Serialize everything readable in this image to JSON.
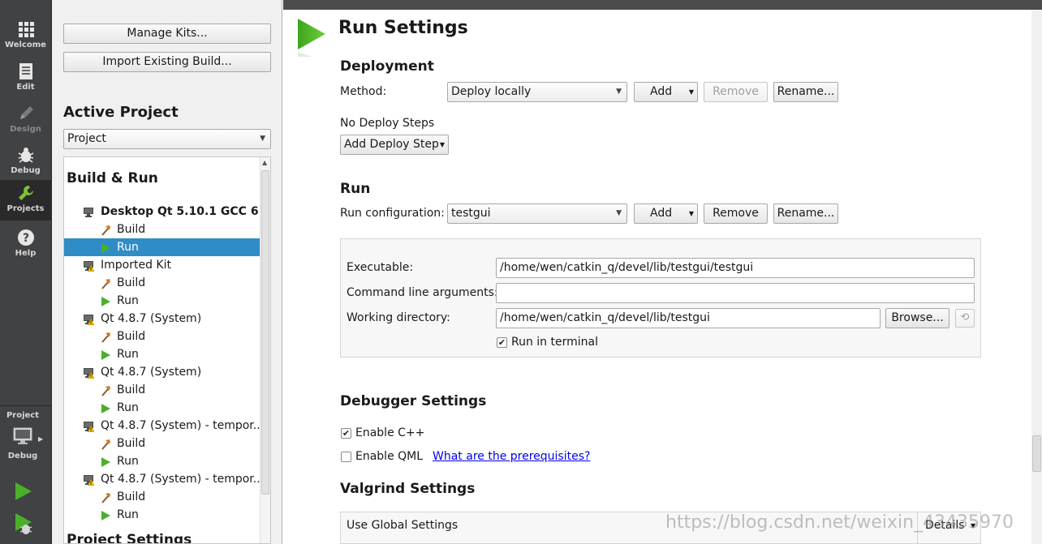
{
  "modebar": {
    "modes": [
      {
        "label": "Welcome",
        "icon": "grid-icon"
      },
      {
        "label": "Edit",
        "icon": "document-icon"
      },
      {
        "label": "Design",
        "icon": "pencil-icon"
      },
      {
        "label": "Debug",
        "icon": "bug-icon"
      },
      {
        "label": "Projects",
        "icon": "wrench-icon"
      },
      {
        "label": "Help",
        "icon": "question-icon"
      }
    ],
    "active_mode": "Projects",
    "kit_selector": {
      "project_label": "Project",
      "build_label": "Debug",
      "icon": "monitor-icon"
    },
    "colors": {
      "run_green": "#4caf2a",
      "active_icon": "#7ec03a"
    }
  },
  "sidebar": {
    "manage_kits_label": "Manage Kits...",
    "import_build_label": "Import Existing Build...",
    "active_project_title": "Active Project",
    "project_combo_value": "Project",
    "build_run_title": "Build & Run",
    "tree": [
      {
        "label": "Desktop Qt 5.10.1 GCC 6...",
        "type": "kit",
        "icon": "monitor-icon",
        "bold": true
      },
      {
        "label": "Build",
        "type": "sub",
        "icon": "hammer-icon"
      },
      {
        "label": "Run",
        "type": "sub",
        "icon": "run-icon",
        "selected": true
      },
      {
        "label": "Imported Kit",
        "type": "kit",
        "icon": "monitor-warning-icon"
      },
      {
        "label": "Build",
        "type": "sub",
        "icon": "hammer-icon"
      },
      {
        "label": "Run",
        "type": "sub",
        "icon": "run-icon"
      },
      {
        "label": "Qt 4.8.7 (System)",
        "type": "kit",
        "icon": "monitor-warning-icon"
      },
      {
        "label": "Build",
        "type": "sub",
        "icon": "hammer-icon"
      },
      {
        "label": "Run",
        "type": "sub",
        "icon": "run-icon"
      },
      {
        "label": "Qt 4.8.7 (System)",
        "type": "kit",
        "icon": "monitor-warning-icon"
      },
      {
        "label": "Build",
        "type": "sub",
        "icon": "hammer-icon"
      },
      {
        "label": "Run",
        "type": "sub",
        "icon": "run-icon"
      },
      {
        "label": "Qt 4.8.7 (System) - tempor...",
        "type": "kit",
        "icon": "monitor-warning-icon"
      },
      {
        "label": "Build",
        "type": "sub",
        "icon": "hammer-icon"
      },
      {
        "label": "Run",
        "type": "sub",
        "icon": "run-icon"
      },
      {
        "label": "Qt 4.8.7 (System) - tempor...",
        "type": "kit",
        "icon": "monitor-warning-icon"
      },
      {
        "label": "Build",
        "type": "sub",
        "icon": "hammer-icon"
      },
      {
        "label": "Run",
        "type": "sub",
        "icon": "run-icon"
      }
    ],
    "project_settings_title": "Project Settings",
    "colors": {
      "selection": "#308cc6"
    }
  },
  "main": {
    "title": "Run Settings",
    "deployment": {
      "title": "Deployment",
      "method_label": "Method:",
      "method_value": "Deploy locally",
      "add_label": "Add",
      "remove_label": "Remove",
      "rename_label": "Rename...",
      "no_steps_text": "No Deploy Steps",
      "add_step_label": "Add Deploy Step"
    },
    "run": {
      "title": "Run",
      "config_label": "Run configuration:",
      "config_value": "testgui",
      "add_label": "Add",
      "remove_label": "Remove",
      "rename_label": "Rename...",
      "executable_label": "Executable:",
      "executable_value": "/home/wen/catkin_q/devel/lib/testgui/testgui",
      "args_label": "Command line arguments:",
      "args_value": "",
      "workdir_label": "Working directory:",
      "workdir_value": "/home/wen/catkin_q/devel/lib/testgui",
      "browse_label": "Browse...",
      "run_in_terminal_label": "Run in terminal",
      "run_in_terminal_checked": true
    },
    "debugger": {
      "title": "Debugger Settings",
      "enable_cpp_label": "Enable C++",
      "enable_cpp_checked": true,
      "enable_qml_label": "Enable QML",
      "enable_qml_checked": false,
      "prereq_link": "What are the prerequisites?"
    },
    "valgrind": {
      "title": "Valgrind Settings",
      "combo_value": "Use Global Settings",
      "details_label": "Details"
    },
    "watermark": "https://blog.csdn.net/weixin_43435970"
  }
}
